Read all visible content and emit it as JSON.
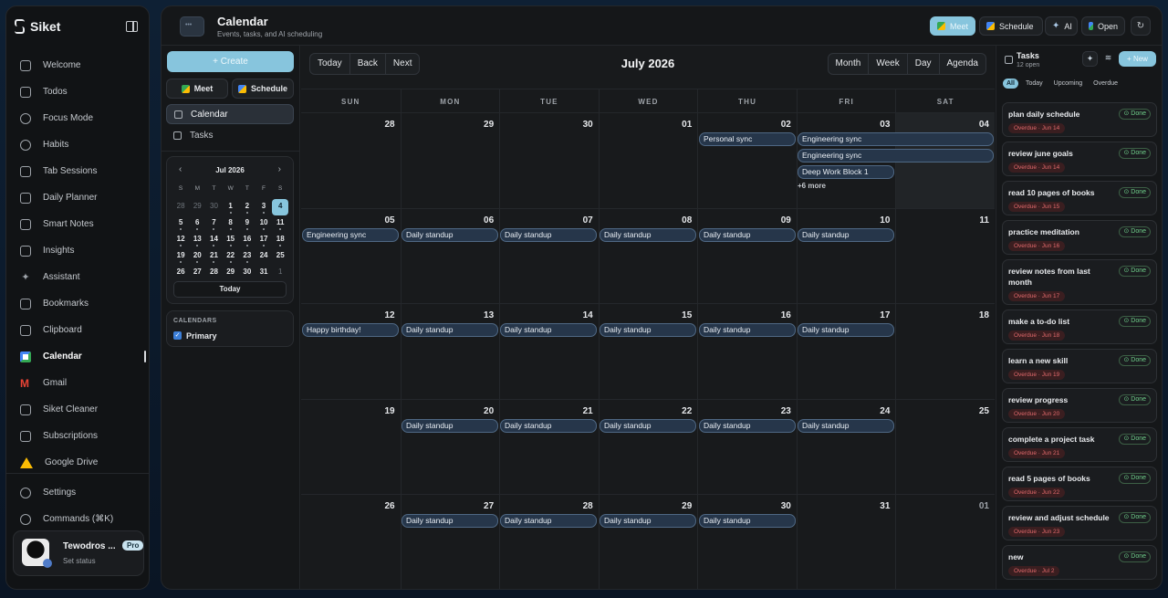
{
  "app": {
    "name": "Siket"
  },
  "nav": {
    "items": [
      {
        "label": "Welcome",
        "icon": "home-icon"
      },
      {
        "label": "Todos",
        "icon": "checkbox-icon"
      },
      {
        "label": "Focus Mode",
        "icon": "shield-icon"
      },
      {
        "label": "Habits",
        "icon": "habits-icon"
      },
      {
        "label": "Tab Sessions",
        "icon": "tabs-icon"
      },
      {
        "label": "Daily Planner",
        "icon": "planner-icon"
      },
      {
        "label": "Smart Notes",
        "icon": "notes-icon"
      },
      {
        "label": "Insights",
        "icon": "chart-icon"
      },
      {
        "label": "Assistant",
        "icon": "sparkle-icon"
      },
      {
        "label": "Bookmarks",
        "icon": "bookmark-icon"
      },
      {
        "label": "Clipboard",
        "icon": "clipboard-icon"
      },
      {
        "label": "Calendar",
        "icon": "google-calendar-icon"
      },
      {
        "label": "Gmail",
        "icon": "gmail-icon"
      },
      {
        "label": "Siket Cleaner",
        "icon": "cleaner-icon"
      },
      {
        "label": "Subscriptions",
        "icon": "subscriptions-icon"
      },
      {
        "label": "Google Drive",
        "icon": "google-drive-icon"
      }
    ],
    "settings": "Settings",
    "commands": "Commands (⌘K)"
  },
  "user": {
    "name": "Tewodros ...",
    "status": "Set status",
    "plan": "Pro"
  },
  "header": {
    "title": "Calendar",
    "subtitle": "Events, tasks, and AI scheduling",
    "meet": "Meet",
    "schedule": "Schedule",
    "ai": "AI",
    "open": "Open"
  },
  "side": {
    "create": "+ Create",
    "meet": "Meet",
    "schedule": "Schedule",
    "calendar": "Calendar",
    "tasks": "Tasks",
    "minical": {
      "title": "Jul 2026",
      "dow": [
        "S",
        "M",
        "T",
        "W",
        "T",
        "F",
        "S"
      ],
      "days": [
        "28",
        "29",
        "30",
        "1",
        "2",
        "3",
        "4",
        "5",
        "6",
        "7",
        "8",
        "9",
        "10",
        "11",
        "12",
        "13",
        "14",
        "15",
        "16",
        "17",
        "18",
        "19",
        "20",
        "21",
        "22",
        "23",
        "24",
        "25",
        "26",
        "27",
        "28",
        "29",
        "30",
        "31",
        "1"
      ],
      "today": "Today"
    },
    "calendars_title": "CALENDARS",
    "calendars": [
      "Primary"
    ]
  },
  "toolbar": {
    "today": "Today",
    "back": "Back",
    "next": "Next",
    "month_title": "July 2026",
    "views": [
      "Month",
      "Week",
      "Day",
      "Agenda"
    ]
  },
  "grid": {
    "dow": [
      "SUN",
      "MON",
      "TUE",
      "WED",
      "THU",
      "FRI",
      "SAT"
    ],
    "weeks": [
      [
        "28",
        "29",
        "30",
        "01",
        "02",
        "03",
        "04"
      ],
      [
        "05",
        "06",
        "07",
        "08",
        "09",
        "10",
        "11"
      ],
      [
        "12",
        "13",
        "14",
        "15",
        "16",
        "17",
        "18"
      ],
      [
        "19",
        "20",
        "21",
        "22",
        "23",
        "24",
        "25"
      ],
      [
        "26",
        "27",
        "28",
        "29",
        "30",
        "31",
        "01"
      ]
    ],
    "events": {
      "personal_sync": "Personal sync",
      "engineering_sync": "Engineering sync",
      "deep_work": "Deep Work Block 1",
      "more": "+6 more",
      "daily_standup": "Daily standup",
      "birthday": "Happy birthday!"
    }
  },
  "tasks": {
    "title": "Tasks",
    "count": "12 open",
    "new": "+ New",
    "filters": [
      "All",
      "Today",
      "Upcoming",
      "Overdue"
    ],
    "done_label": "Done",
    "items": [
      {
        "name": "plan daily schedule",
        "due": "Overdue · Jun 14"
      },
      {
        "name": "review june goals",
        "due": "Overdue · Jun 14"
      },
      {
        "name": "read 10 pages of books",
        "due": "Overdue · Jun 15"
      },
      {
        "name": "practice meditation",
        "due": "Overdue · Jun 16"
      },
      {
        "name": "review notes from last month",
        "due": "Overdue · Jun 17"
      },
      {
        "name": "make a to-do list",
        "due": "Overdue · Jun 18"
      },
      {
        "name": "learn a new skill",
        "due": "Overdue · Jun 19"
      },
      {
        "name": "review progress",
        "due": "Overdue · Jun 20"
      },
      {
        "name": "complete a project task",
        "due": "Overdue · Jun 21"
      },
      {
        "name": "read 5 pages of books",
        "due": "Overdue · Jun 22"
      },
      {
        "name": "review and adjust schedule",
        "due": "Overdue · Jun 23"
      },
      {
        "name": "new",
        "due": "Overdue · Jul 2"
      }
    ]
  }
}
